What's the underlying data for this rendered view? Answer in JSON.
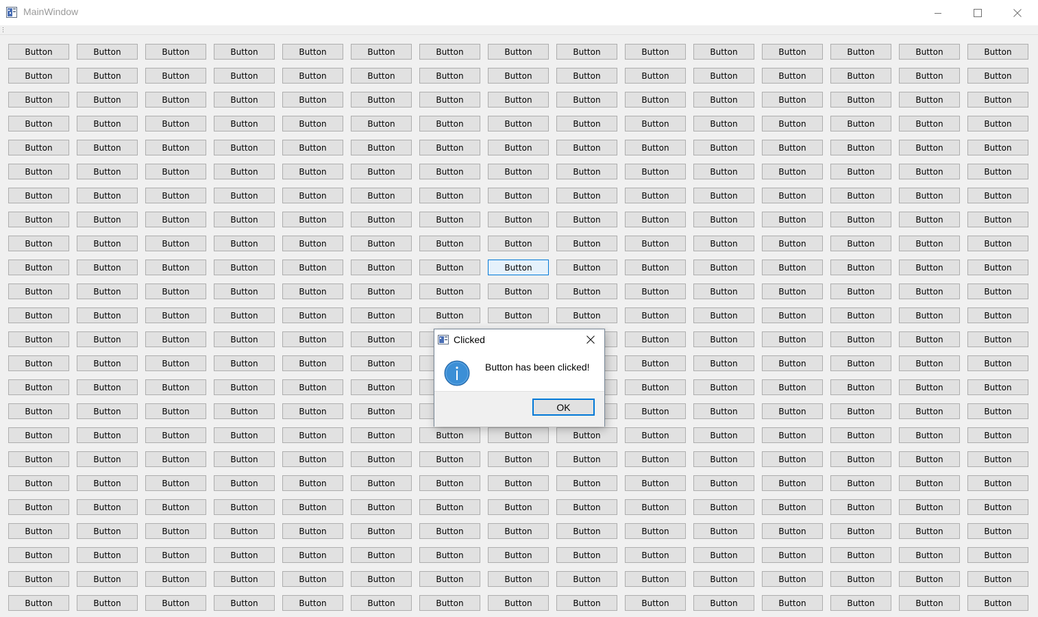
{
  "window": {
    "title": "MainWindow",
    "icons": {
      "app": "app-icon",
      "minimize": "minimize-icon",
      "maximize": "maximize-icon",
      "close": "close-icon"
    }
  },
  "grid": {
    "columns": 15,
    "rows": 24,
    "button_label": "Button",
    "focused_button": {
      "row": 9,
      "col": 7
    }
  },
  "dialog": {
    "title": "Clicked",
    "message": "Button has been clicked!",
    "ok_label": "OK",
    "icon": "information-icon"
  },
  "colors": {
    "focus_border": "#0078d7",
    "button_face": "#e1e1e1",
    "info_icon": "#3c8fd6"
  }
}
